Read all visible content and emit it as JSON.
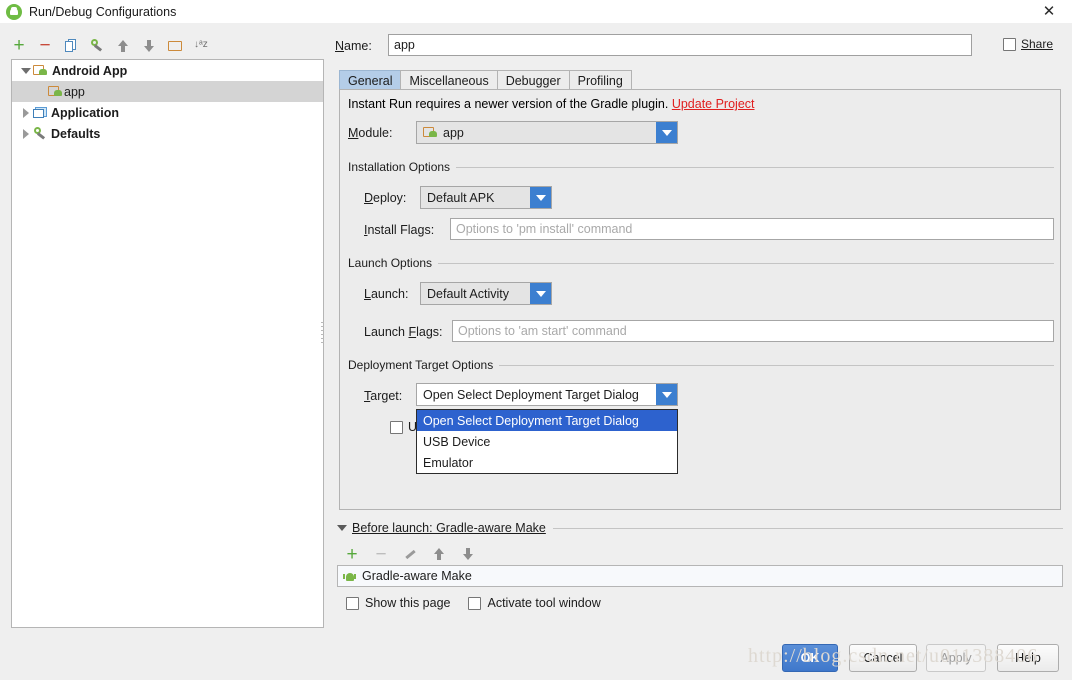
{
  "window": {
    "title": "Run/Debug Configurations",
    "app_icon": "android-studio-icon",
    "close_label": "✕"
  },
  "left_toolbar": {
    "buttons": [
      {
        "name": "add-configuration-button",
        "glyph": "+"
      },
      {
        "name": "remove-configuration-button",
        "glyph": "−"
      },
      {
        "name": "copy-configuration-button",
        "glyph": "copy-icon"
      },
      {
        "name": "edit-defaults-button",
        "glyph": "wrench-icon"
      },
      {
        "name": "move-up-button",
        "glyph": "arrow-up-icon"
      },
      {
        "name": "move-down-button",
        "glyph": "arrow-down-icon"
      },
      {
        "name": "create-folder-button",
        "glyph": "folder-icon"
      },
      {
        "name": "sort-configurations-button",
        "glyph": "sort-az-icon"
      }
    ],
    "sort_glyph": "↓ᵃz"
  },
  "tree": {
    "nodes": [
      {
        "label": "Android App",
        "expanded": true,
        "bold": true,
        "icon": "android-folder-icon",
        "indent": 0,
        "selected": false
      },
      {
        "label": "app",
        "expanded": null,
        "bold": false,
        "icon": "android-folder-icon",
        "indent": 1,
        "selected": true
      },
      {
        "label": "Application",
        "expanded": false,
        "bold": true,
        "icon": "app-window-icon",
        "indent": 0,
        "selected": false
      },
      {
        "label": "Defaults",
        "expanded": false,
        "bold": true,
        "icon": "wrench-icon",
        "indent": 0,
        "selected": false
      }
    ]
  },
  "form": {
    "name_label": "Name:",
    "name_value": "app",
    "share_label": "Share",
    "share_checked": false
  },
  "tabs": [
    {
      "label": "General",
      "active": true
    },
    {
      "label": "Miscellaneous",
      "active": false
    },
    {
      "label": "Debugger",
      "active": false
    },
    {
      "label": "Profiling",
      "active": false
    }
  ],
  "general": {
    "notice_text": "Instant Run requires a newer version of the Gradle plugin.",
    "notice_link": "Update Project",
    "module_label": "Module:",
    "module_value": "app",
    "installation_group": "Installation Options",
    "deploy_label": "Deploy:",
    "deploy_value": "Default APK",
    "install_flags_label": "Install Flags:",
    "install_flags_value": "",
    "install_flags_placeholder": "Options to 'pm install' command",
    "launch_group": "Launch Options",
    "launch_label": "Launch:",
    "launch_value": "Default Activity",
    "launch_flags_label": "Launch Flags:",
    "launch_flags_value": "",
    "launch_flags_placeholder": "Options to 'am start' command",
    "deployment_group": "Deployment Target Options",
    "target_label": "Target:",
    "target_value": "Open Select Deployment Target Dialog",
    "hidden_checkbox_label": "U",
    "hidden_checkbox_checked": false
  },
  "target_dropdown": {
    "open": true,
    "options": [
      {
        "label": "Open Select Deployment Target Dialog",
        "selected": true
      },
      {
        "label": "USB Device",
        "selected": false
      },
      {
        "label": "Emulator",
        "selected": false
      }
    ]
  },
  "before_launch": {
    "header": "Before launch: Gradle-aware Make",
    "toolbar": [
      {
        "name": "add-task-button",
        "glyph": "+"
      },
      {
        "name": "remove-task-button",
        "glyph": "−"
      },
      {
        "name": "edit-task-button",
        "glyph": "pencil-icon"
      },
      {
        "name": "task-move-up-button",
        "glyph": "arrow-up-icon"
      },
      {
        "name": "task-move-down-button",
        "glyph": "arrow-down-icon"
      }
    ],
    "tasks": [
      {
        "label": "Gradle-aware Make",
        "icon": "android-icon"
      }
    ],
    "show_page_label": "Show this page",
    "show_page_checked": false,
    "activate_tool_window_label": "Activate tool window",
    "activate_tool_window_checked": false
  },
  "footer": {
    "ok_label": "OK",
    "cancel_label": "Cancel",
    "apply_label": "Apply",
    "help_label": "Help",
    "watermark": "http://blog.csdn.net/u011388406"
  },
  "colors": {
    "accent_blue": "#3c7fd0",
    "dropdown_selected": "#2d62ce",
    "tab_active": "#b4cde8",
    "link_red": "#e02020",
    "android_green": "#7ab648",
    "panel_bg": "#ececec"
  }
}
